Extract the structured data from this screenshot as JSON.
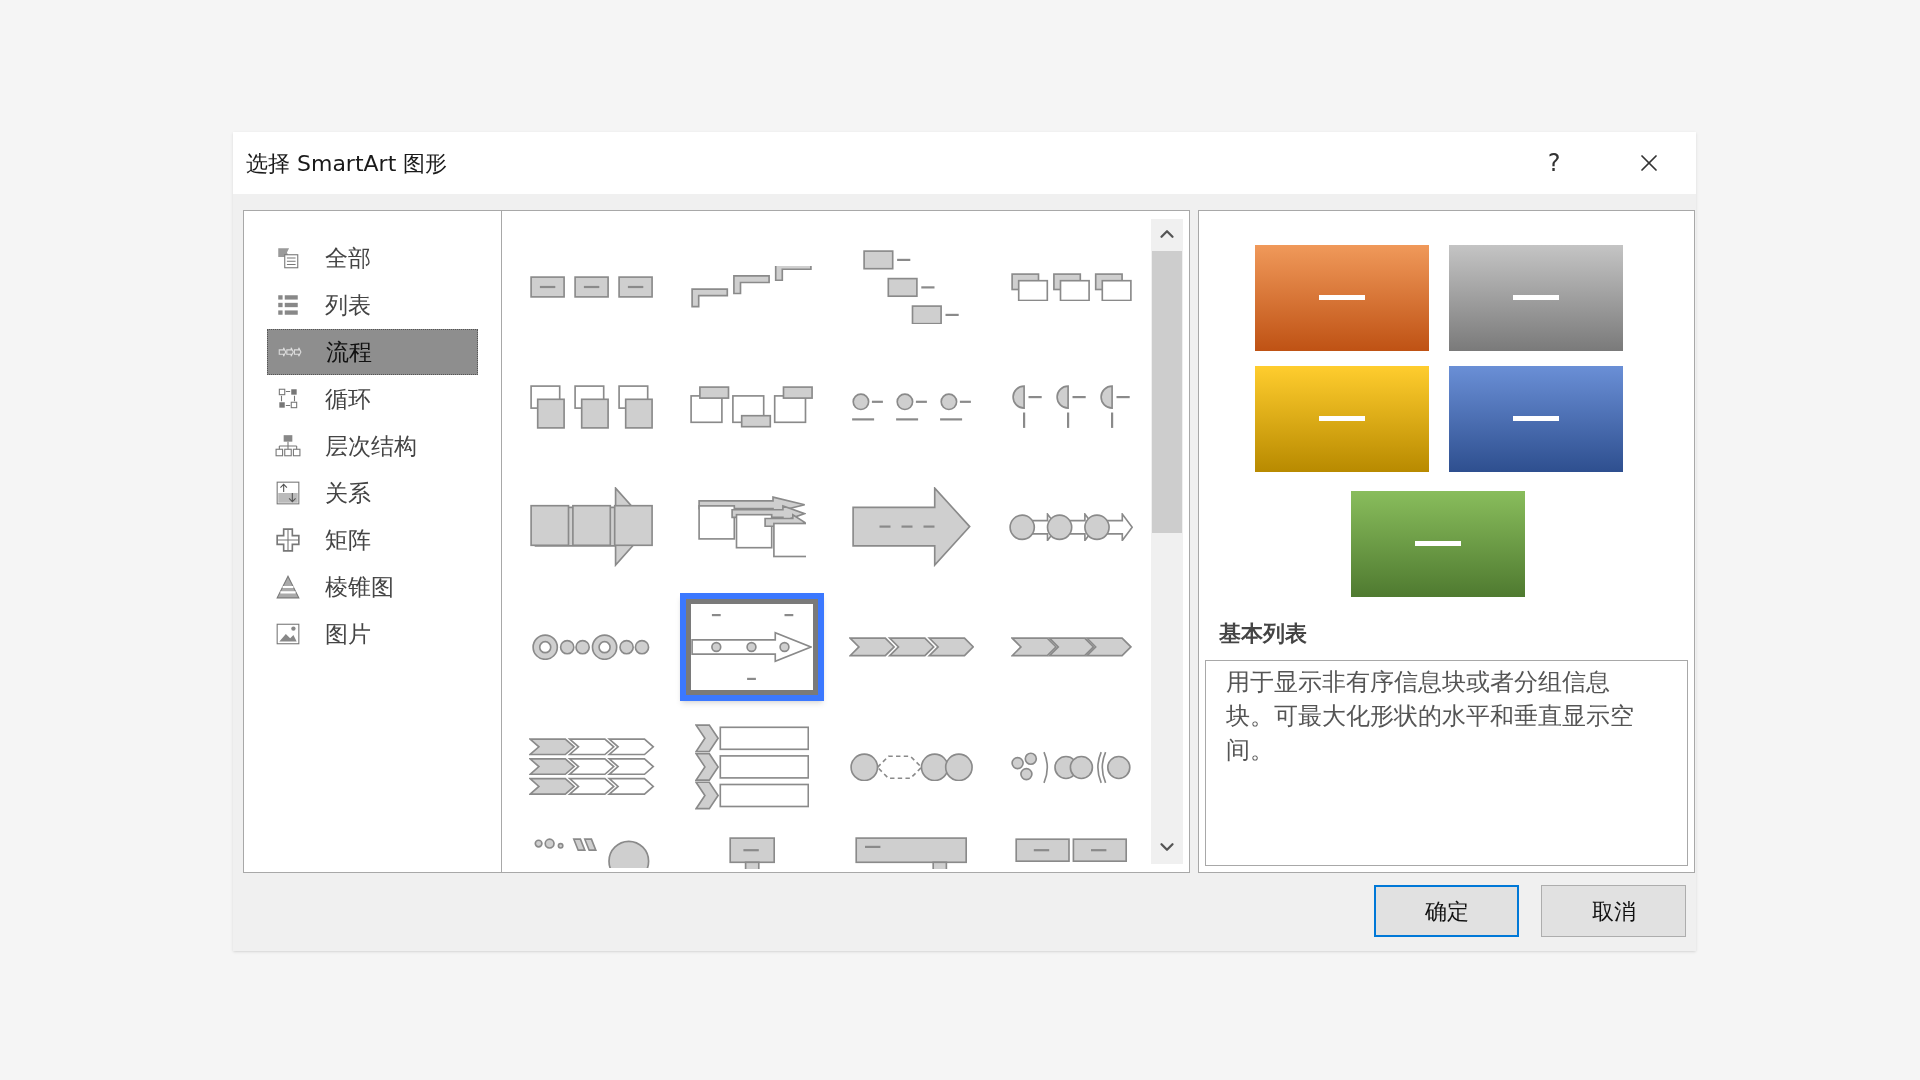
{
  "window": {
    "title": "选择 SmartArt 图形",
    "help": "?"
  },
  "categories": [
    {
      "label": "全部",
      "selected": false
    },
    {
      "label": "列表",
      "selected": false
    },
    {
      "label": "流程",
      "selected": true
    },
    {
      "label": "循环",
      "selected": false
    },
    {
      "label": "层次结构",
      "selected": false
    },
    {
      "label": "关系",
      "selected": false
    },
    {
      "label": "矩阵",
      "selected": false
    },
    {
      "label": "棱锥图",
      "selected": false
    },
    {
      "label": "图片",
      "selected": false
    }
  ],
  "gallery": {
    "items": [
      {
        "selected": false
      },
      {
        "selected": false
      },
      {
        "selected": false
      },
      {
        "selected": false
      },
      {
        "selected": false
      },
      {
        "selected": false
      },
      {
        "selected": false
      },
      {
        "selected": false
      },
      {
        "selected": false
      },
      {
        "selected": false
      },
      {
        "selected": false
      },
      {
        "selected": false
      },
      {
        "selected": false
      },
      {
        "selected": true
      },
      {
        "selected": false
      },
      {
        "selected": false
      },
      {
        "selected": false
      },
      {
        "selected": false
      },
      {
        "selected": false
      },
      {
        "selected": false
      },
      {
        "selected": false
      },
      {
        "selected": false
      },
      {
        "selected": false
      },
      {
        "selected": false
      }
    ]
  },
  "preview": {
    "title": "基本列表",
    "description": "用于显示非有序信息块或者分组信息块。可最大化形状的水平和垂直显示空间。"
  },
  "buttons": [
    {
      "label": "确定",
      "default": true
    },
    {
      "label": "取消",
      "default": false
    }
  ]
}
